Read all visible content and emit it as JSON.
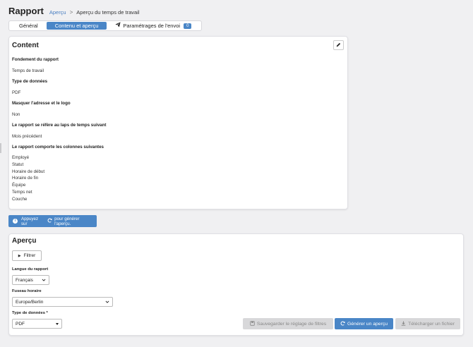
{
  "header": {
    "title": "Rapport",
    "breadcrumb_link": "Aperçu",
    "breadcrumb_separator": ">",
    "breadcrumb_current": "Aperçu du temps de travail"
  },
  "tabs": [
    {
      "label": "Général",
      "active": false
    },
    {
      "label": "Contenu et aperçu",
      "active": true
    },
    {
      "label": "Paramétrages de l'envoi",
      "active": false,
      "badge": "0"
    }
  ],
  "content": {
    "title": "Content",
    "fields": [
      {
        "label": "Fondement du rapport",
        "value": "Temps de travail"
      },
      {
        "label": "Type de données",
        "value": "PDF"
      },
      {
        "label": "Masquer l'adresse et le logo",
        "value": "Non"
      },
      {
        "label": "Le rapport se réfère au laps de temps suivant",
        "value": "Mois précédent"
      }
    ],
    "columns_label": "Le rapport comporte les colonnes suivantes",
    "columns": [
      "Employé",
      "Statut",
      "Horaire de début",
      "Horaire de fin",
      "Équipe",
      "Temps net",
      "Couche"
    ]
  },
  "info": {
    "text_before": "Appuyez sur",
    "text_after": "pour générer l'aperçu."
  },
  "preview": {
    "title": "Aperçu",
    "filter_label": "Filtrer",
    "language_label": "Langue du rapport",
    "language_value": "Français",
    "timezone_label": "Fuseau horaire",
    "timezone_value": "Europe/Berlin",
    "datatype_label": "Type de données *",
    "datatype_value": "PDF",
    "save_filters_label": "Sauvegarder le réglage de filtres",
    "generate_label": "Générer un aperçu",
    "download_label": "Télécharger un fichier"
  },
  "colors": {
    "accent": "#4a86c7",
    "link": "#4a7fc1",
    "disabled_bg": "#d8d8da",
    "disabled_text": "#888888"
  }
}
